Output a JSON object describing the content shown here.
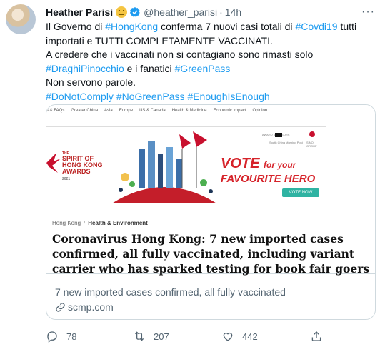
{
  "tweet": {
    "author_name": "Heather Parisi",
    "handle": "@heather_parisi",
    "separator": "·",
    "time": "14h",
    "more_label": "···",
    "lines": [
      [
        {
          "t": "Il Governo di ",
          "link": false
        },
        {
          "t": "#HongKong",
          "link": true
        },
        {
          "t": " conferma 7 nuovi casi totali di ",
          "link": false
        },
        {
          "t": "#Covdi19",
          "link": true
        },
        {
          "t": " tutti",
          "link": false
        }
      ],
      [
        {
          "t": "importati e TUTTI COMPLETAMENTE VACCINATI.",
          "link": false
        }
      ],
      [
        {
          "t": "A credere che i vaccinati non si contagiano sono rimasti solo",
          "link": false
        }
      ],
      [
        {
          "t": "#DraghiPinocchio",
          "link": true
        },
        {
          "t": " e i fanatici ",
          "link": false
        },
        {
          "t": "#GreenPass",
          "link": true
        }
      ],
      [
        {
          "t": "Non servono parole.",
          "link": false
        }
      ],
      [
        {
          "t": "#DoNotComply",
          "link": true
        },
        {
          "t": " ",
          "link": false
        },
        {
          "t": "#NoGreenPass",
          "link": true
        },
        {
          "t": " ",
          "link": false
        },
        {
          "t": "#EnoughIsEnough",
          "link": true
        }
      ]
    ]
  },
  "card": {
    "nav_items": [
      "s & FAQs",
      "Greater China",
      "Asia",
      "Europe",
      "US & Canada",
      "Health & Medicine",
      "Economic Impact",
      "Opinion"
    ],
    "banner": {
      "spirit_lines": [
        "THE",
        "SPIRIT OF",
        "HONG KONG",
        "AWARDS"
      ],
      "spirit_year": "2021",
      "vote_line1": "VOTE",
      "vote_line1_small": "for your",
      "vote_line2": "FAVOURITE HERO",
      "vote_button": "VOTE NOW",
      "sponsor_text_left": "AWARD SPONSORS",
      "sponsor_text_mid": "South China Morning Post",
      "sponsor_text_right": "SINO GROUP"
    },
    "section_primary": "Hong Kong",
    "section_separator": "/",
    "section_secondary": "Health & Environment",
    "headline": "Coronavirus Hong Kong: 7 new imported cases confirmed, all fully vaccinated, including variant carrier who has sparked testing for book fair goers",
    "description": "7 new imported cases confirmed, all fully vaccinated",
    "domain": "scmp.com"
  },
  "actions": {
    "replies": "78",
    "retweets": "207",
    "likes": "442"
  },
  "colors": {
    "link": "#1d9bf0",
    "secondary_text": "#536471",
    "border": "#cfd9de",
    "verified": "#1d9bf0",
    "vote_red": "#d6232a",
    "vote_button": "#2fb3a2"
  }
}
